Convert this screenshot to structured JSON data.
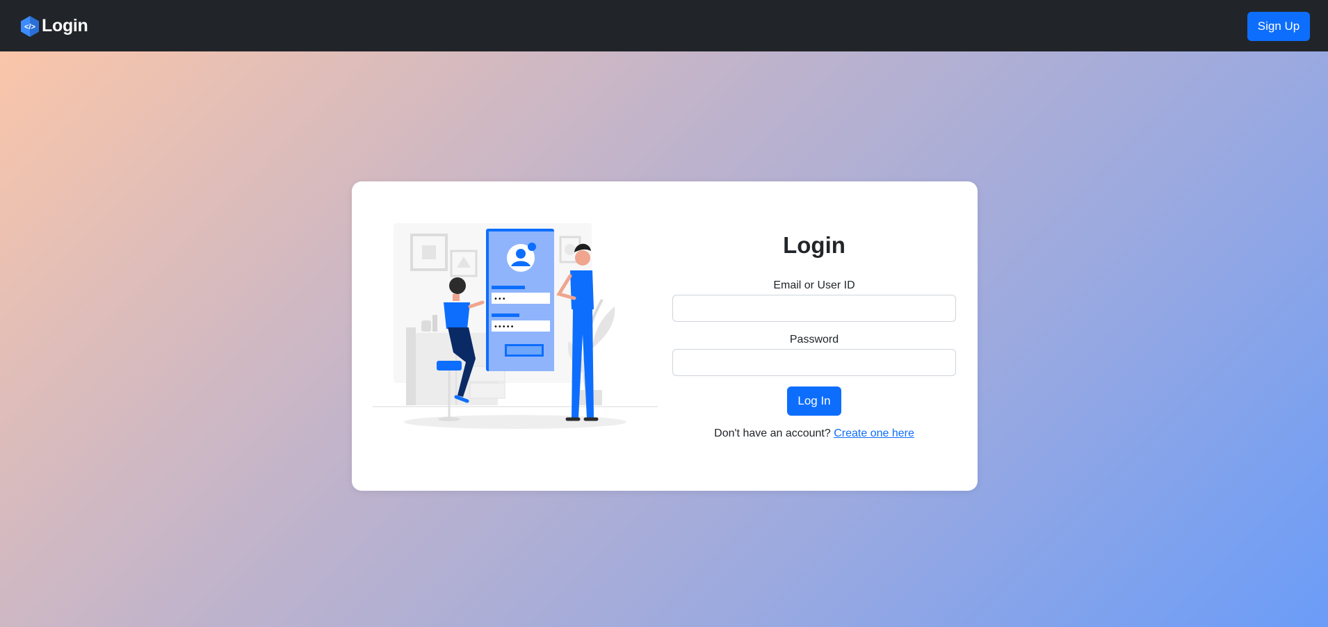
{
  "navbar": {
    "brand_text": "Login",
    "brand_icon": "code-hexagon-icon",
    "signup_label": "Sign Up"
  },
  "login": {
    "title": "Login",
    "email_label": "Email or User ID",
    "email_value": "",
    "password_label": "Password",
    "password_value": "",
    "submit_label": "Log In",
    "no_account_text": "Don't have an account?",
    "create_link_text": "Create one here"
  },
  "illustration": {
    "password_field_1_mask": "•••",
    "password_field_2_mask": "•••••"
  },
  "colors": {
    "navbar": "#212529",
    "accent": "#0d6efd",
    "gradient_start": "#fec7a7",
    "gradient_end": "#6b9cf8"
  }
}
